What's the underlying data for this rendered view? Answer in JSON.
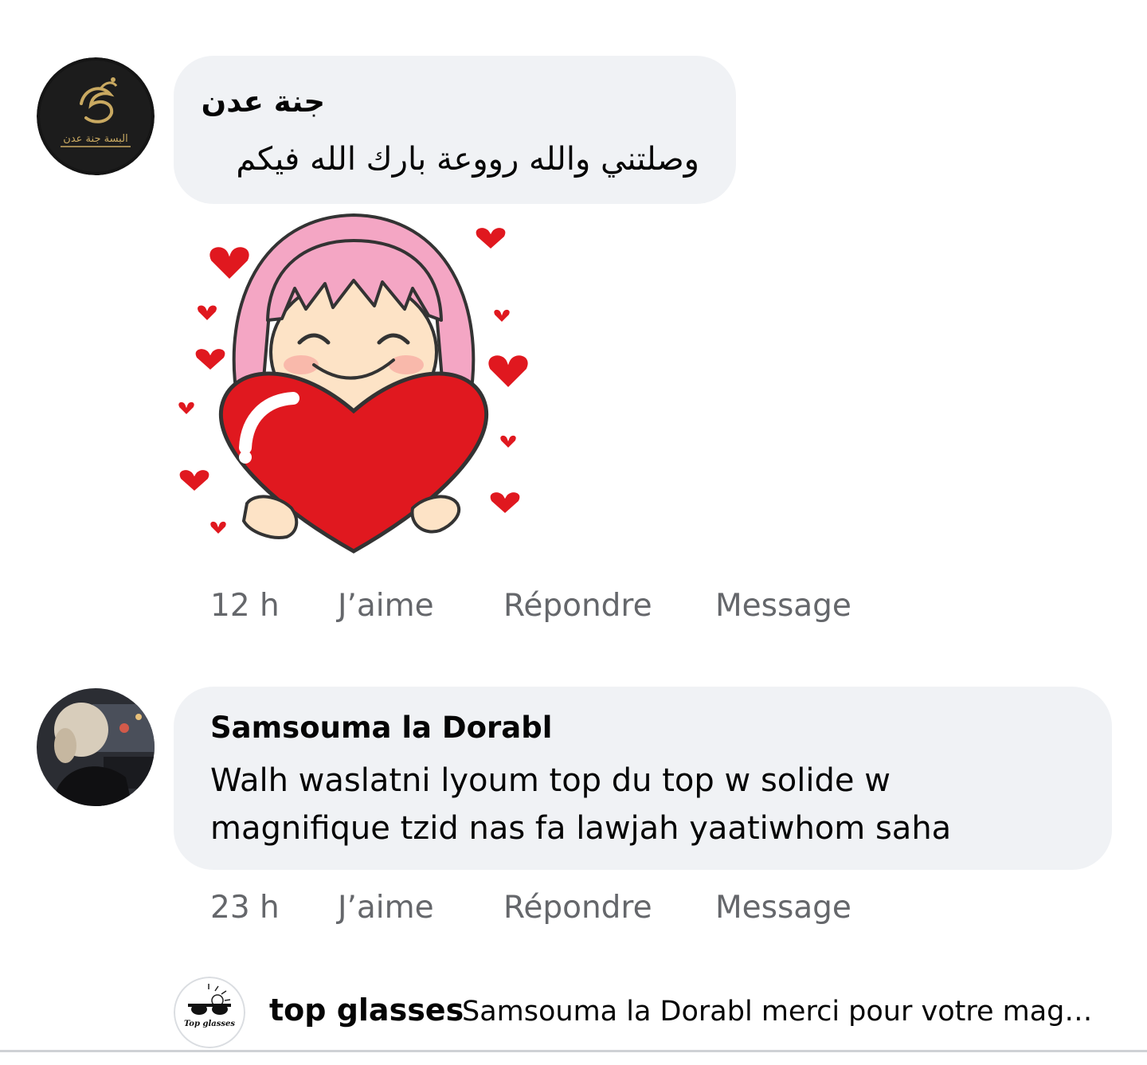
{
  "comments": [
    {
      "author": "جنة عدن",
      "text": "وصلتني والله رووعة بارك الله فيكم",
      "avatar_caption": "البسة جنة عدن",
      "has_sticker": true,
      "time": "12 h",
      "like_label": "J’aime",
      "reply_label": "Répondre",
      "message_label": "Message"
    },
    {
      "author": "Samsouma la Dorabl",
      "text_line1": "Walh waslatni lyoum top du top w solide w",
      "text_line2": "magnifique tzid nas fa lawjah yaatiwhom saha",
      "time": "23 h",
      "like_label": "J’aime",
      "reply_label": "Répondre",
      "message_label": "Message"
    }
  ],
  "reply_preview": {
    "author": "top glasses",
    "text": "Samsouma la Dorabl merci pour votre magni…",
    "avatar_caption": "Top glasses"
  },
  "colors": {
    "bubble": "#f0f2f5",
    "secondary_text": "#65676b",
    "heart_red": "#e0181f",
    "hair_pink": "#f4a6c4"
  },
  "icons": {
    "sticker": "girl-hugging-heart-sticker",
    "glasses": "sunglasses-icon"
  }
}
